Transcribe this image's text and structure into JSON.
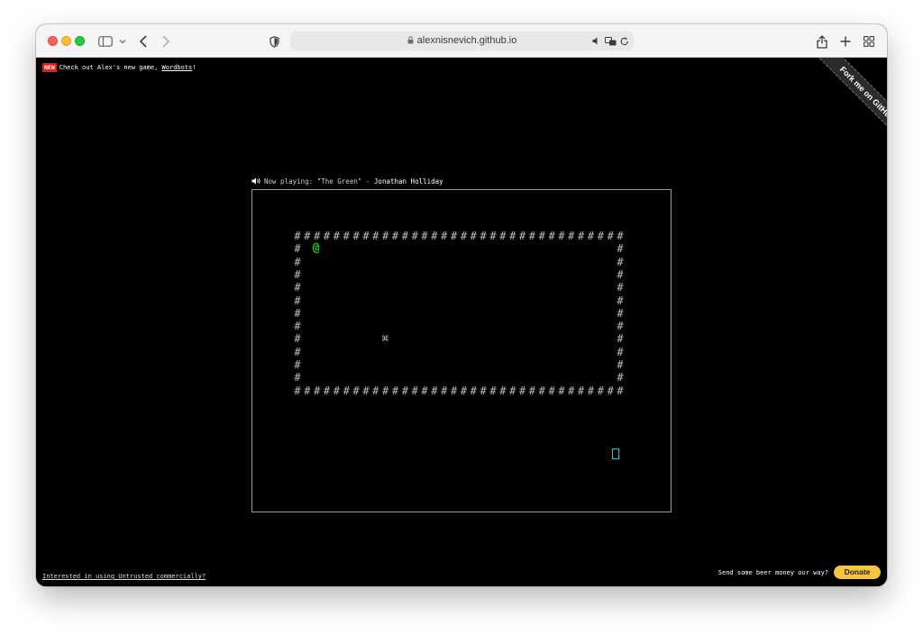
{
  "browser": {
    "url": "alexnisnevich.github.io"
  },
  "notice": {
    "badge": "NEW",
    "text_before": "Check out Alex's new game, ",
    "link": "Wordbots",
    "text_after": "!"
  },
  "ribbon": {
    "label": "Fork me on GitHub"
  },
  "now_playing": {
    "prefix": "Now playing: \"The Green\" - ",
    "artist": "Jonathan Holliday"
  },
  "game": {
    "wall_char": "#",
    "player_char": "@",
    "computer_char": "⌘",
    "wall_cols": 34,
    "wall_rows": 13,
    "player_cell": [
      2,
      1
    ],
    "computer_cell": [
      9,
      8
    ],
    "colors": {
      "player": "#19d219",
      "exit": "#19d3d3",
      "wall": "#bdbdbd"
    }
  },
  "footer": {
    "commercial_link": "Interested in using Untrusted commercially?",
    "beer_text": "Send some beer money our way?",
    "donate_label": "Donate"
  }
}
